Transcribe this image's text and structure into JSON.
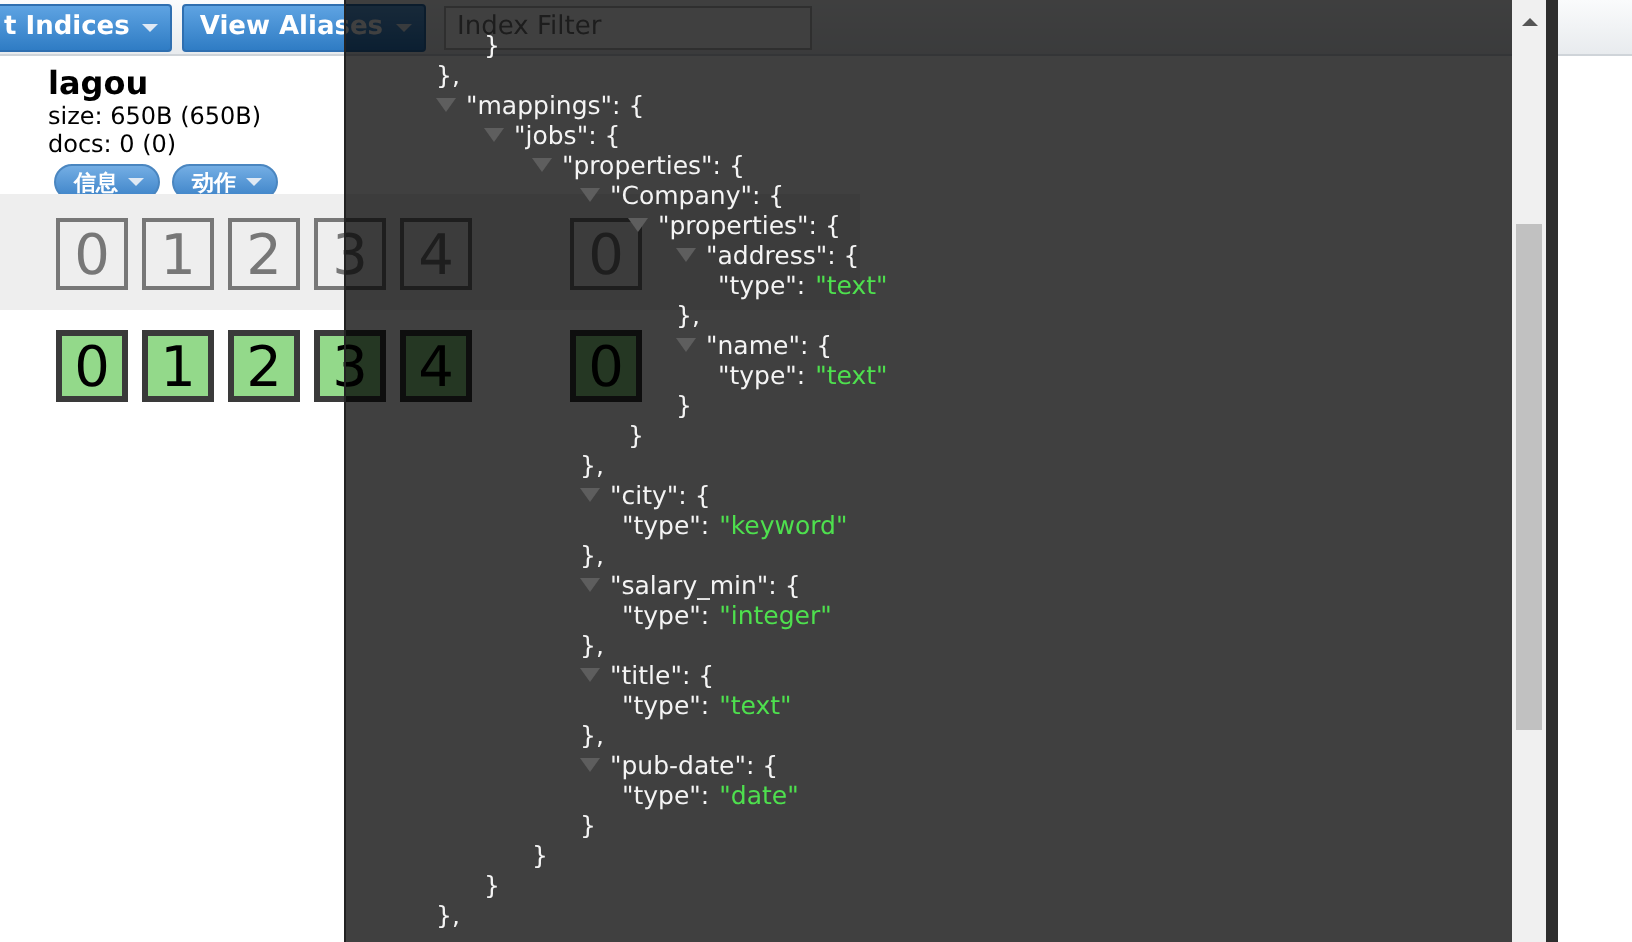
{
  "toolbar": {
    "buttons": [
      {
        "label": "t Indices"
      },
      {
        "label": "View Aliases"
      }
    ],
    "filter": {
      "placeholder": "Index Filter"
    }
  },
  "cluster": {
    "indices": [
      {
        "name": "lagou",
        "size": "size: 650B (650B)",
        "docs": "docs: 0 (0)",
        "actions": [
          "信息",
          "动作"
        ]
      }
    ],
    "shard_rows": [
      {
        "kind": "unassigned",
        "cells": [
          [
            "0",
            "1",
            "2",
            "3",
            "4"
          ],
          [
            "0"
          ]
        ]
      },
      {
        "kind": "started",
        "cells": [
          [
            "0",
            "1",
            "2",
            "3",
            "4"
          ],
          [
            "0"
          ]
        ]
      }
    ]
  },
  "json_viewer": {
    "nodes": [
      {
        "kind": "object",
        "children": [
          {
            "kind": "close",
            "text": "}"
          }
        ],
        "tail": "},"
      },
      {
        "kind": "object",
        "head": "\"mappings\": {",
        "expanded": true,
        "tail": "},",
        "children": [
          {
            "kind": "object",
            "head": "\"jobs\": {",
            "expanded": true,
            "tail": "}",
            "children": [
              {
                "kind": "object",
                "head": "\"properties\": {",
                "expanded": true,
                "tail": "}",
                "children": [
                  {
                    "kind": "object",
                    "head": "\"Company\": {",
                    "expanded": true,
                    "tail": "},",
                    "children": [
                      {
                        "kind": "object",
                        "head": "\"properties\": {",
                        "expanded": true,
                        "tail": "}",
                        "children": [
                          {
                            "kind": "object",
                            "head": "\"address\": {",
                            "expanded": true,
                            "tail": "},",
                            "children": [
                              {
                                "kind": "leaf",
                                "key": "\"type\":",
                                "value": "\"text\""
                              }
                            ]
                          },
                          {
                            "kind": "object",
                            "head": "\"name\": {",
                            "expanded": true,
                            "tail": "}",
                            "children": [
                              {
                                "kind": "leaf",
                                "key": "\"type\":",
                                "value": "\"text\""
                              }
                            ]
                          }
                        ]
                      }
                    ]
                  },
                  {
                    "kind": "object",
                    "head": "\"city\": {",
                    "expanded": true,
                    "tail": "},",
                    "children": [
                      {
                        "kind": "leaf",
                        "key": "\"type\":",
                        "value": "\"keyword\""
                      }
                    ]
                  },
                  {
                    "kind": "object",
                    "head": "\"salary_min\": {",
                    "expanded": true,
                    "tail": "},",
                    "children": [
                      {
                        "kind": "leaf",
                        "key": "\"type\":",
                        "value": "\"integer\""
                      }
                    ]
                  },
                  {
                    "kind": "object",
                    "head": "\"title\": {",
                    "expanded": true,
                    "tail": "},",
                    "children": [
                      {
                        "kind": "leaf",
                        "key": "\"type\":",
                        "value": "\"text\""
                      }
                    ]
                  },
                  {
                    "kind": "object",
                    "head": "\"pub-date\": {",
                    "expanded": true,
                    "tail": "}",
                    "children": [
                      {
                        "kind": "leaf",
                        "key": "\"type\":",
                        "value": "\"date\""
                      }
                    ]
                  }
                ]
              }
            ]
          }
        ]
      }
    ]
  }
}
